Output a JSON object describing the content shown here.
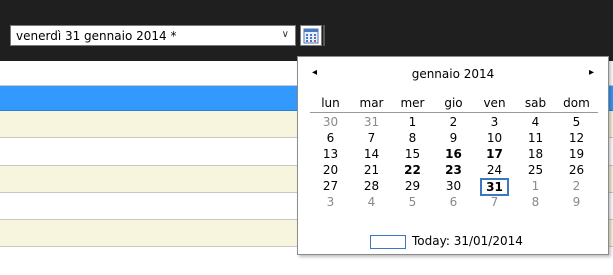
{
  "date_picker": {
    "value": "venerdì 31 gennaio 2014 *",
    "dropdown_icon": "chevron-down-icon",
    "calendar_icon": "calendar-icon"
  },
  "colors": {
    "topbar_bg": "#1f1f1f",
    "row_white": "#ffffff",
    "row_selected": "#3399ff",
    "row_alt": "#f7f5de",
    "accent": "#3b78c2"
  },
  "calendar": {
    "month_label": "gennaio 2014",
    "prev_icon": "◂",
    "next_icon": "▸",
    "weekdays": [
      "lun",
      "mar",
      "mer",
      "gio",
      "ven",
      "sab",
      "dom"
    ],
    "weeks": [
      [
        {
          "d": "30",
          "m": true
        },
        {
          "d": "31",
          "m": true
        },
        {
          "d": "1"
        },
        {
          "d": "2"
        },
        {
          "d": "3"
        },
        {
          "d": "4"
        },
        {
          "d": "5"
        }
      ],
      [
        {
          "d": "6"
        },
        {
          "d": "7"
        },
        {
          "d": "8"
        },
        {
          "d": "9"
        },
        {
          "d": "10"
        },
        {
          "d": "11"
        },
        {
          "d": "12"
        }
      ],
      [
        {
          "d": "13"
        },
        {
          "d": "14"
        },
        {
          "d": "15"
        },
        {
          "d": "16",
          "b": true
        },
        {
          "d": "17",
          "b": true
        },
        {
          "d": "18"
        },
        {
          "d": "19"
        }
      ],
      [
        {
          "d": "20"
        },
        {
          "d": "21"
        },
        {
          "d": "22",
          "b": true
        },
        {
          "d": "23",
          "b": true
        },
        {
          "d": "24"
        },
        {
          "d": "25"
        },
        {
          "d": "26"
        }
      ],
      [
        {
          "d": "27"
        },
        {
          "d": "28"
        },
        {
          "d": "29"
        },
        {
          "d": "30"
        },
        {
          "d": "31",
          "s": true
        },
        {
          "d": "1",
          "m": true
        },
        {
          "d": "2",
          "m": true
        }
      ],
      [
        {
          "d": "3",
          "m": true
        },
        {
          "d": "4",
          "m": true
        },
        {
          "d": "5",
          "m": true
        },
        {
          "d": "6",
          "m": true
        },
        {
          "d": "7",
          "m": true
        },
        {
          "d": "8",
          "m": true
        },
        {
          "d": "9",
          "m": true
        }
      ]
    ],
    "today_label": "Today: 31/01/2014"
  }
}
